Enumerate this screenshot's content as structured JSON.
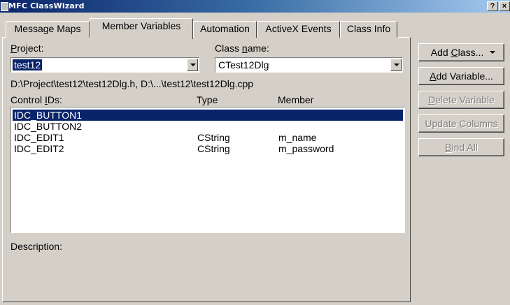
{
  "window": {
    "title": "MFC ClassWizard",
    "help_glyph": "?",
    "close_glyph": "×"
  },
  "tabs": [
    {
      "label": "Message Maps",
      "active": false
    },
    {
      "label": "Member Variables",
      "active": true
    },
    {
      "label": "Automation",
      "active": false
    },
    {
      "label": "ActiveX Events",
      "active": false
    },
    {
      "label": "Class Info",
      "active": false
    }
  ],
  "project": {
    "label_pre": "",
    "label_ul": "P",
    "label_post": "roject:",
    "value": "test12"
  },
  "class_name": {
    "label_pre": "Class ",
    "label_ul": "n",
    "label_post": "ame:",
    "value": "CTest12Dlg"
  },
  "file_path": "D:\\Project\\test12\\test12Dlg.h, D:\\...\\test12\\test12Dlg.cpp",
  "columns": {
    "id_pre": "Control ",
    "id_ul": "I",
    "id_post": "Ds:",
    "type": "Type",
    "member": "Member"
  },
  "rows": [
    {
      "id": "IDC_BUTTON1",
      "type": "",
      "member": "",
      "selected": true
    },
    {
      "id": "IDC_BUTTON2",
      "type": "",
      "member": "",
      "selected": false
    },
    {
      "id": "IDC_EDIT1",
      "type": "CString",
      "member": "m_name",
      "selected": false
    },
    {
      "id": "IDC_EDIT2",
      "type": "CString",
      "member": "m_password",
      "selected": false
    }
  ],
  "description_label": "Description:",
  "buttons": {
    "add_class_pre": "Add ",
    "add_class_ul": "C",
    "add_class_post": "lass...",
    "add_variable_pre": "",
    "add_variable_ul": "A",
    "add_variable_post": "dd Variable...",
    "delete_variable_pre": "",
    "delete_variable_ul": "D",
    "delete_variable_post": "elete Variable",
    "update_columns_pre": "Update ",
    "update_columns_ul": "C",
    "update_columns_post": "olumns",
    "bind_all_pre": "",
    "bind_all_ul": "B",
    "bind_all_post": "ind All"
  },
  "colors": {
    "face": "#d4d0c8",
    "selection": "#0a246a",
    "title_start": "#0a246a",
    "title_end": "#a6caf0",
    "disabled_text": "#808080"
  }
}
